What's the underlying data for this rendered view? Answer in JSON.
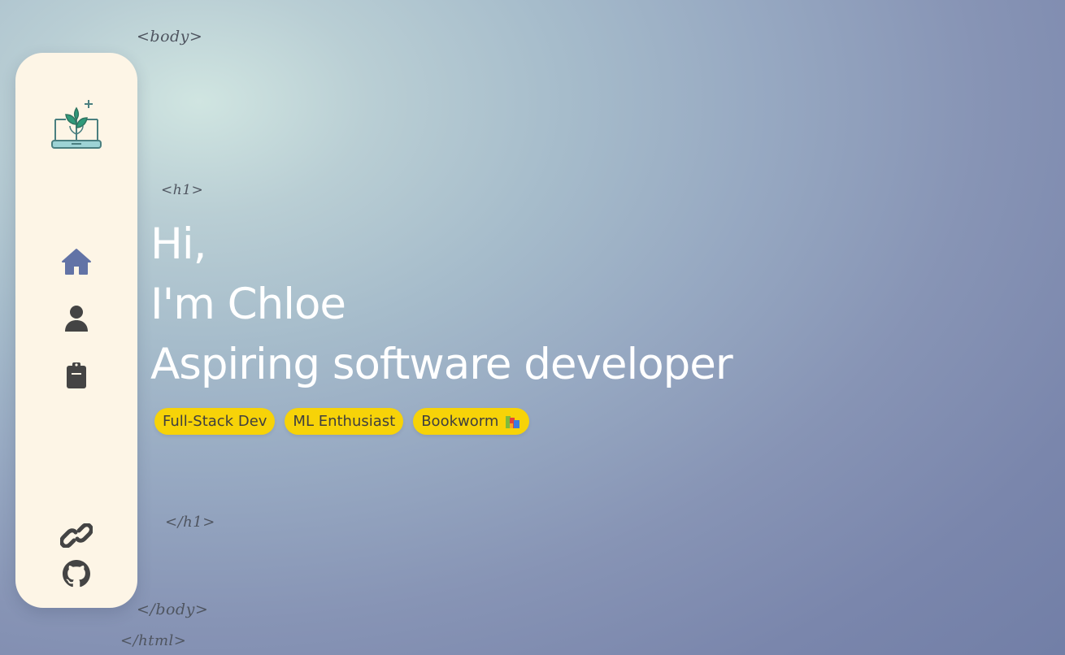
{
  "code_tags": {
    "body_open": "<body>",
    "h1_open": "<h1>",
    "h1_close": "</h1>",
    "body_close": "</body>",
    "html_close": "</html>"
  },
  "sidebar": {
    "logo_icon": "laptop-plant-logo",
    "nav_items": [
      {
        "icon": "home-icon",
        "active": true
      },
      {
        "icon": "user-icon",
        "active": false
      },
      {
        "icon": "clipboard-icon",
        "active": false
      }
    ],
    "bottom_items": [
      {
        "icon": "link-icon"
      },
      {
        "icon": "github-icon"
      }
    ]
  },
  "hero": {
    "line1": "Hi,",
    "line2": "I'm Chloe",
    "line3": "Aspiring software developer"
  },
  "chips": [
    {
      "label": "Full-Stack Dev"
    },
    {
      "label": "ML Enthusiast"
    },
    {
      "label": "Bookworm"
    }
  ],
  "colors": {
    "sidebar_bg": "#fdf5e6",
    "active_icon": "#6273a6",
    "inactive_icon": "#444444",
    "chip_bg": "#f7d308",
    "hero_text": "#ffffff"
  }
}
